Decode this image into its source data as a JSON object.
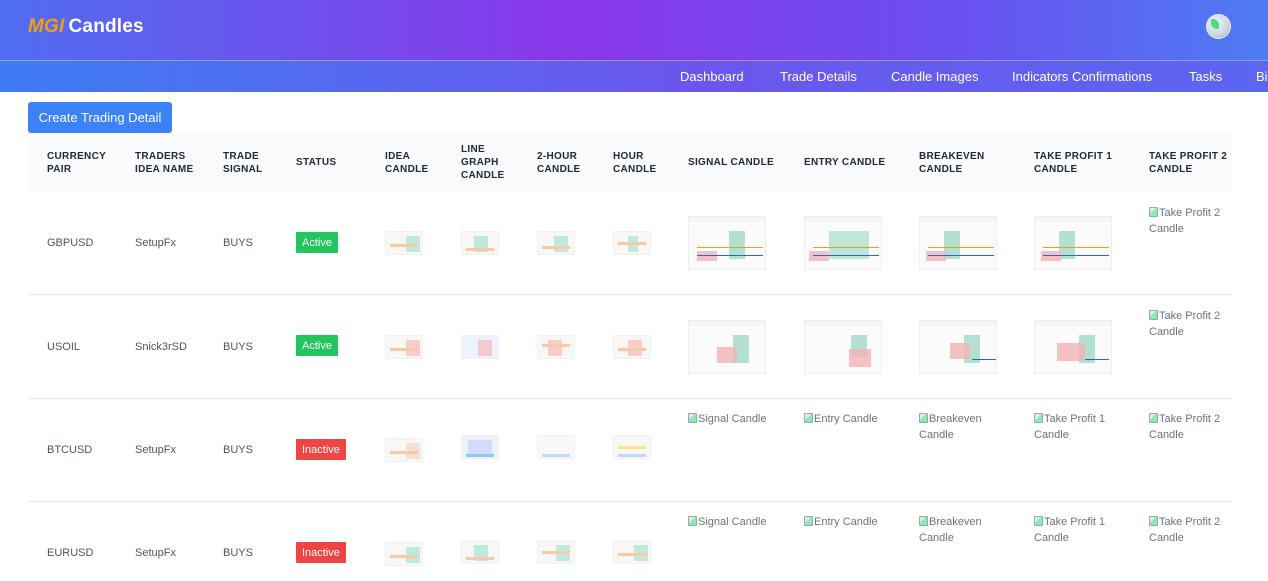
{
  "app": {
    "logo_prefix": "MGI",
    "logo_name": "Candles"
  },
  "nav": {
    "items": [
      "Dashboard",
      "Trade Details",
      "Candle Images",
      "Indicators Confirmations",
      "Tasks",
      "Bi"
    ]
  },
  "actions": {
    "create_label": "Create Trading Detail"
  },
  "table": {
    "headers": {
      "currency_pair": "CURRENCY PAIR",
      "idea_name": "TRADERS IDEA NAME",
      "signal": "TRADE SIGNAL",
      "status": "STATUS",
      "idea_candle": "IDEA CANDLE",
      "line_graph": "LINE GRAPH CANDLE",
      "two_hour": "2-HOUR CANDLE",
      "hour": "HOUR CANDLE",
      "signal_candle": "SIGNAL CANDLE",
      "entry_candle": "ENTRY CANDLE",
      "breakeven": "BREAKEVEN CANDLE",
      "tp1": "TAKE PROFIT 1 CANDLE",
      "tp2": "TAKE PROFIT 2 CANDLE"
    },
    "rows": [
      {
        "pair": "GBPUSD",
        "idea": "SetupFx",
        "signal": "BUYS",
        "status": "Active",
        "signal_alt": "",
        "entry_alt": "",
        "breakeven_alt": "",
        "tp1_alt": "",
        "tp2_alt": "Take Profit 2 Candle"
      },
      {
        "pair": "USOIL",
        "idea": "Snick3rSD",
        "signal": "BUYS",
        "status": "Active",
        "signal_alt": "",
        "entry_alt": "",
        "breakeven_alt": "",
        "tp1_alt": "",
        "tp2_alt": "Take Profit 2 Candle"
      },
      {
        "pair": "BTCUSD",
        "idea": "SetupFx",
        "signal": "BUYS",
        "status": "Inactive",
        "signal_alt": "Signal Candle",
        "entry_alt": "Entry Candle",
        "breakeven_alt": "Breakeven Candle",
        "tp1_alt": "Take Profit 1 Candle",
        "tp2_alt": "Take Profit 2 Candle"
      },
      {
        "pair": "EURUSD",
        "idea": "SetupFx",
        "signal": "BUYS",
        "status": "Inactive",
        "signal_alt": "Signal Candle",
        "entry_alt": "Entry Candle",
        "breakeven_alt": "Breakeven Candle",
        "tp1_alt": "Take Profit 1 Candle",
        "tp2_alt": "Take Profit 2 Candle"
      }
    ]
  },
  "colors": {
    "active": "#22c55e",
    "inactive": "#ef4444",
    "primary": "#3b82f6",
    "logo_accent": "#f59e0b"
  }
}
